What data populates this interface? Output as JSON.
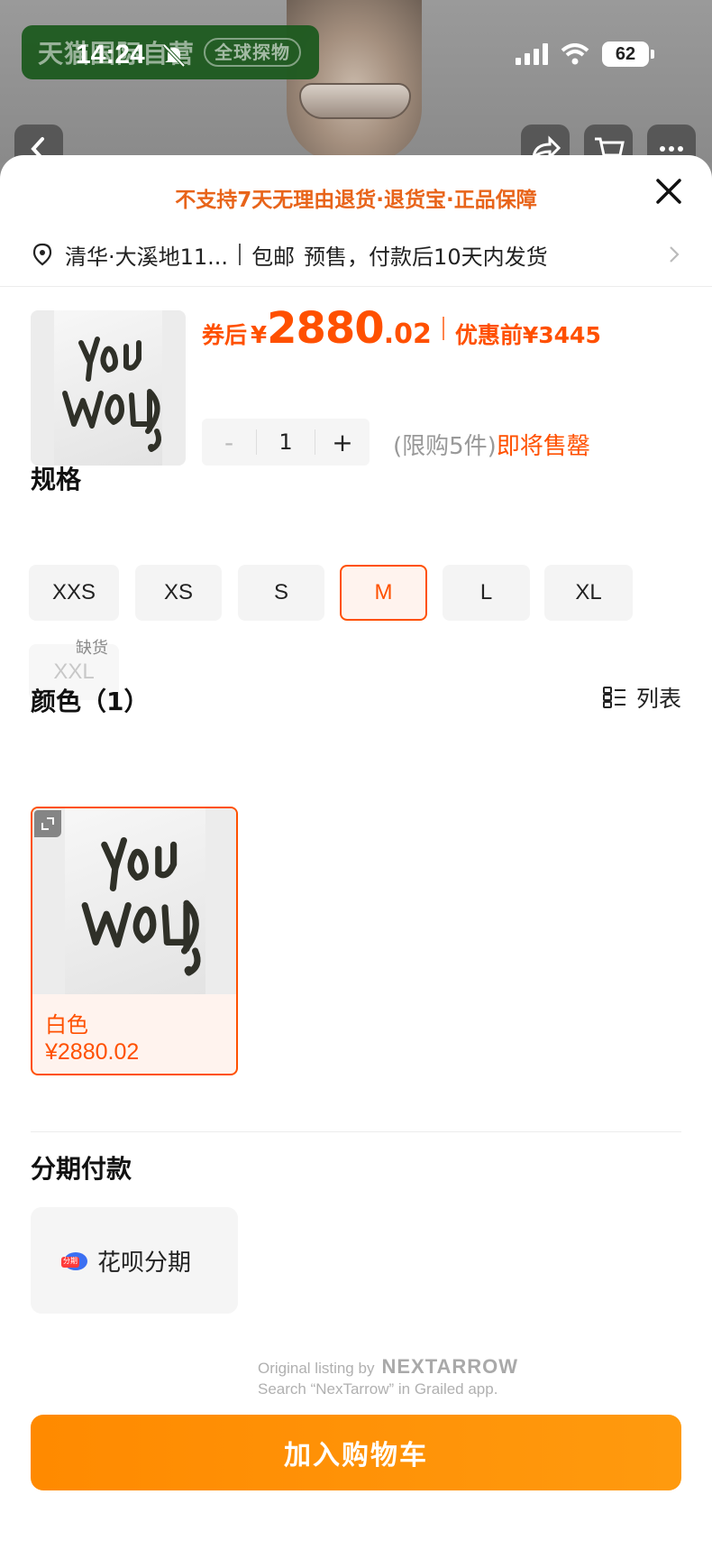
{
  "status_bar": {
    "time": "14:24",
    "battery": "62",
    "icons": [
      "bell-slash-icon",
      "signal-icon",
      "wifi-icon",
      "battery-icon"
    ]
  },
  "background": {
    "store_name": "天猫国际自营",
    "store_tag": "全球探物"
  },
  "sheet": {
    "notice": "不支持7天无理由退货·退货宝·正品保障",
    "address": "清华·大溪地11...",
    "shipping": "包邮",
    "delivery": "预售，付款后10天内发货"
  },
  "product": {
    "price_prefix": "券后",
    "currency": "¥",
    "price_main": "2880",
    "price_decimal": ".02",
    "orig_price": "优惠前¥3445",
    "quantity": "1",
    "minus": "-",
    "plus": "+",
    "limit_text": "(限购5件)",
    "stock_text": "即将售罄"
  },
  "specs": {
    "title": "规格",
    "sizes": [
      "XXS",
      "XS",
      "S",
      "M",
      "L",
      "XL",
      "XXL"
    ],
    "selected": "M",
    "unavailable": "XXL",
    "oos_label": "缺货"
  },
  "colors": {
    "title": "颜色（1）",
    "view_toggle": "列表",
    "items": [
      {
        "name": "白色",
        "price": "¥2880.02"
      }
    ]
  },
  "installment": {
    "title": "分期付款",
    "option": "花呗分期",
    "icon_label": "分期"
  },
  "watermark": {
    "line1": "Original listing by",
    "brand": "NEXTARROW",
    "line2": "Search “NexTarrow” in Grailed app."
  },
  "cta": {
    "add_to_cart": "加入购物车"
  },
  "colors_theme": {
    "accent": "#ff5000",
    "cta": "#ff8a00",
    "notice": "#e8641a"
  }
}
